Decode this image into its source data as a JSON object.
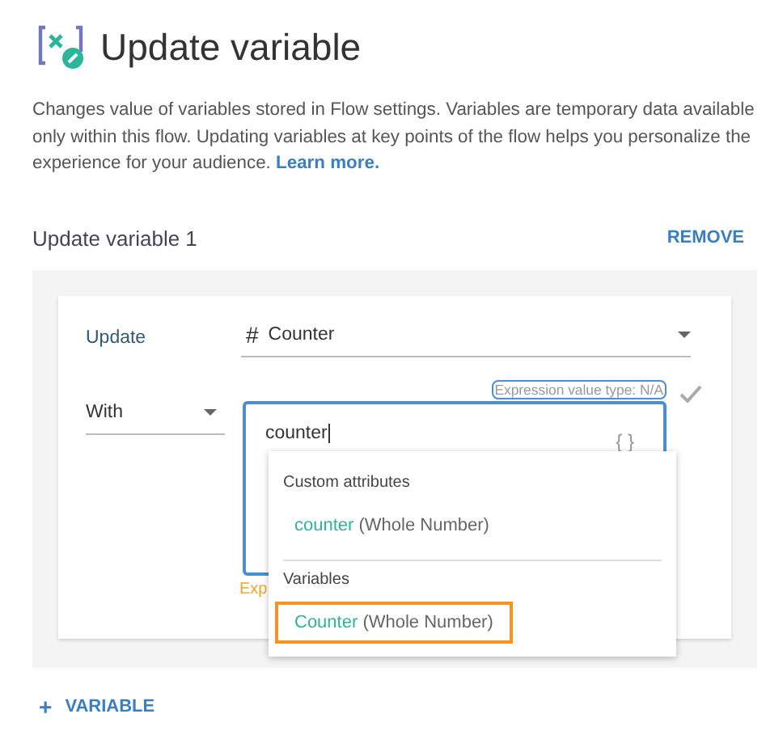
{
  "header": {
    "title": "Update variable",
    "description": "Changes value of variables stored in Flow settings. Variables are temporary data available only within this flow. Updating variables at key points of the flow helps you personalize the experience for your audience.",
    "link": "Learn more."
  },
  "section": {
    "title": "Update variable 1",
    "remove": "REMOVE"
  },
  "update_row": {
    "label": "Update",
    "type_symbol": "#",
    "value": "Counter"
  },
  "with_row": {
    "mode": "With",
    "hint": "Expression value type: N/A",
    "expression": "counter",
    "braces": "{ }",
    "error": "Exp"
  },
  "suggestions": {
    "groups": [
      {
        "title": "Custom attributes",
        "items": [
          {
            "name": "counter",
            "type": "(Whole Number)",
            "selected": false
          }
        ]
      },
      {
        "title": "Variables",
        "items": [
          {
            "name": "Counter",
            "type": "(Whole Number)",
            "selected": true
          }
        ]
      }
    ]
  },
  "add_button": {
    "icon": "+",
    "label": "VARIABLE"
  }
}
